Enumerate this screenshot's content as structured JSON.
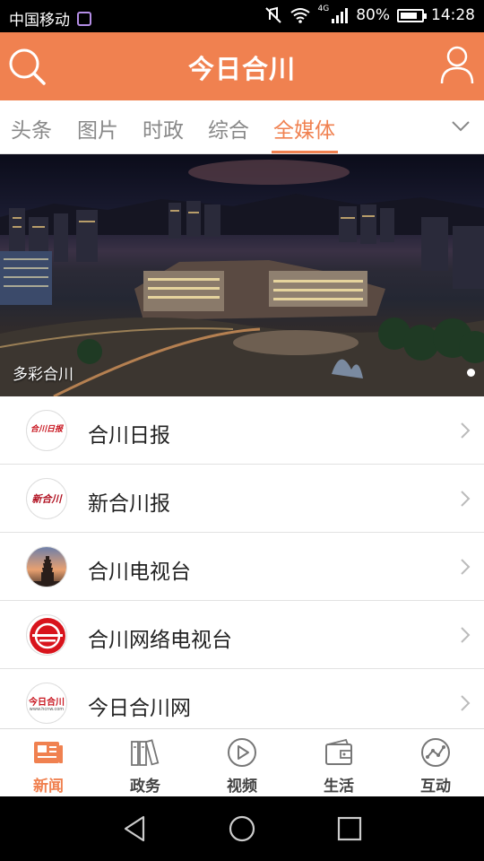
{
  "status_bar": {
    "carrier": "中国移动",
    "network": "4G",
    "battery": "80%",
    "battery_level": 0.8,
    "time": "14:28"
  },
  "header": {
    "title": "今日合川"
  },
  "tabs": [
    {
      "label": "头条"
    },
    {
      "label": "图片"
    },
    {
      "label": "时政"
    },
    {
      "label": "综合"
    },
    {
      "label": "全媒体",
      "active": true
    }
  ],
  "banner": {
    "caption": "多彩合川"
  },
  "media_list": [
    {
      "label": "合川日报",
      "logo_text": "合川日报"
    },
    {
      "label": "新合川报",
      "logo_text": "新合川"
    },
    {
      "label": "合川电视台"
    },
    {
      "label": "合川网络电视台"
    },
    {
      "label": "今日合川网",
      "logo_text": "今日合川",
      "logo_subtext": "www.hcnw.com"
    }
  ],
  "bottom_nav": [
    {
      "label": "新闻",
      "icon": "newspaper-icon",
      "active": true
    },
    {
      "label": "政务",
      "icon": "books-icon"
    },
    {
      "label": "视频",
      "icon": "play-icon"
    },
    {
      "label": "生活",
      "icon": "wallet-icon"
    },
    {
      "label": "互动",
      "icon": "chart-icon"
    }
  ],
  "colors": {
    "accent": "#f08150",
    "tab_inactive": "#888888",
    "text": "#222222"
  }
}
